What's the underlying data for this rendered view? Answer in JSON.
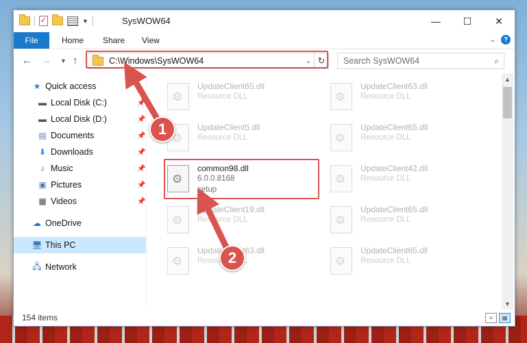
{
  "window": {
    "title": "SysWOW64",
    "controls": {
      "minimize": "—",
      "maximize": "☐",
      "close": "✕"
    }
  },
  "ribbon": {
    "tabs": [
      "File",
      "Home",
      "Share",
      "View"
    ]
  },
  "nav": {
    "address": "C:\\Windows\\SysWOW64",
    "search_placeholder": "Search SysWOW64"
  },
  "sidebar": {
    "items": [
      {
        "label": "Quick access",
        "icon": "star-icon"
      },
      {
        "label": "Local Disk (C:)",
        "icon": "drive-icon",
        "pinned": true
      },
      {
        "label": "Local Disk (D:)",
        "icon": "drive-icon",
        "pinned": true
      },
      {
        "label": "Documents",
        "icon": "documents-icon",
        "pinned": true
      },
      {
        "label": "Downloads",
        "icon": "download-icon",
        "pinned": true
      },
      {
        "label": "Music",
        "icon": "music-icon",
        "pinned": true
      },
      {
        "label": "Pictures",
        "icon": "pictures-icon",
        "pinned": true
      },
      {
        "label": "Videos",
        "icon": "videos-icon",
        "pinned": true
      },
      {
        "label": "OneDrive",
        "icon": "cloud-icon"
      },
      {
        "label": "This PC",
        "icon": "computer-icon",
        "selected": true
      },
      {
        "label": "Network",
        "icon": "network-icon"
      }
    ]
  },
  "files": [
    {
      "name": "UpdateClient65.dll",
      "desc": "Resource DLL"
    },
    {
      "name": "UpdateClient63.dll",
      "desc": "Resource DLL"
    },
    {
      "name": "UpdateClient5.dll",
      "desc": "Resource DLL"
    },
    {
      "name": "UpdateClient65.dll",
      "desc": "Resource DLL"
    },
    {
      "name": "common98.dll",
      "desc": "6.0.0.8168",
      "desc2": "setup"
    },
    {
      "name": "UpdateClient42.dll",
      "desc": "Resource DLL"
    },
    {
      "name": "UpdateClient19.dll",
      "desc": "Resource DLL"
    },
    {
      "name": "UpdateClient65.dll",
      "desc": "Resource DLL"
    },
    {
      "name": "UpdateClient63.dll",
      "desc": "Resource DLL"
    },
    {
      "name": "UpdateClient65.dll",
      "desc": "Resource DLL"
    }
  ],
  "status": {
    "item_count": "154 items"
  },
  "annotations": {
    "marker1": "1",
    "marker2": "2",
    "color": "#d9534f"
  }
}
